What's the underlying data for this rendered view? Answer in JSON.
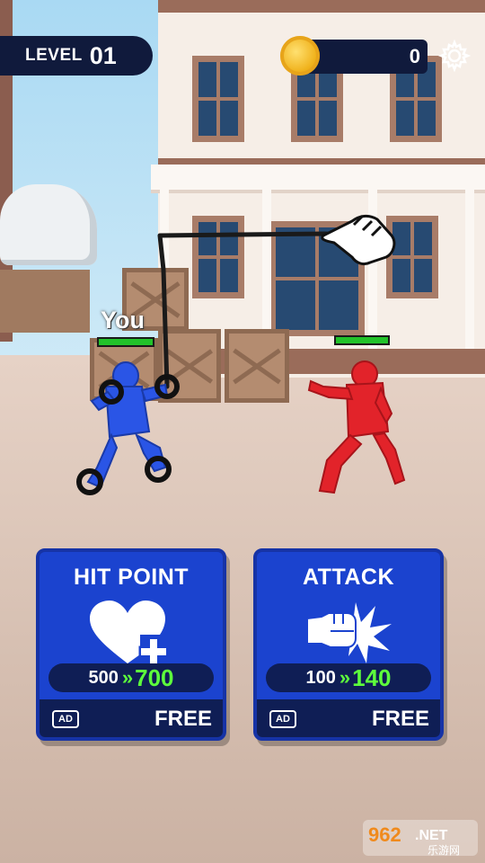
{
  "hud": {
    "level_label": "LEVEL",
    "level_number": "01",
    "coin_icon": "coin-icon",
    "coin_count": "0",
    "settings_icon": "gear-icon"
  },
  "fighters": {
    "player_label": "You",
    "player_health": 1.0,
    "enemy_health": 1.0,
    "player_color": "#2a55e6",
    "enemy_color": "#e2232a"
  },
  "tutorial": {
    "hand_icon": "pointing-hand-icon"
  },
  "cards": [
    {
      "title": "HIT POINT",
      "icon": "heart-plus-icon",
      "stat_old": "500",
      "arrow": "»",
      "stat_new": "700",
      "ad_label": "AD",
      "cost_label": "FREE"
    },
    {
      "title": "ATTACK",
      "icon": "punch-icon",
      "stat_old": "100",
      "arrow": "»",
      "stat_new": "140",
      "ad_label": "AD",
      "cost_label": "FREE"
    }
  ],
  "watermark": {
    "logo": "962.NET",
    "subtitle": "乐游网"
  },
  "colors": {
    "card_blue": "#1b43cf",
    "card_dark": "#0f1e55",
    "highlight_green": "#5dff3c",
    "hud_navy": "#101a3c"
  }
}
